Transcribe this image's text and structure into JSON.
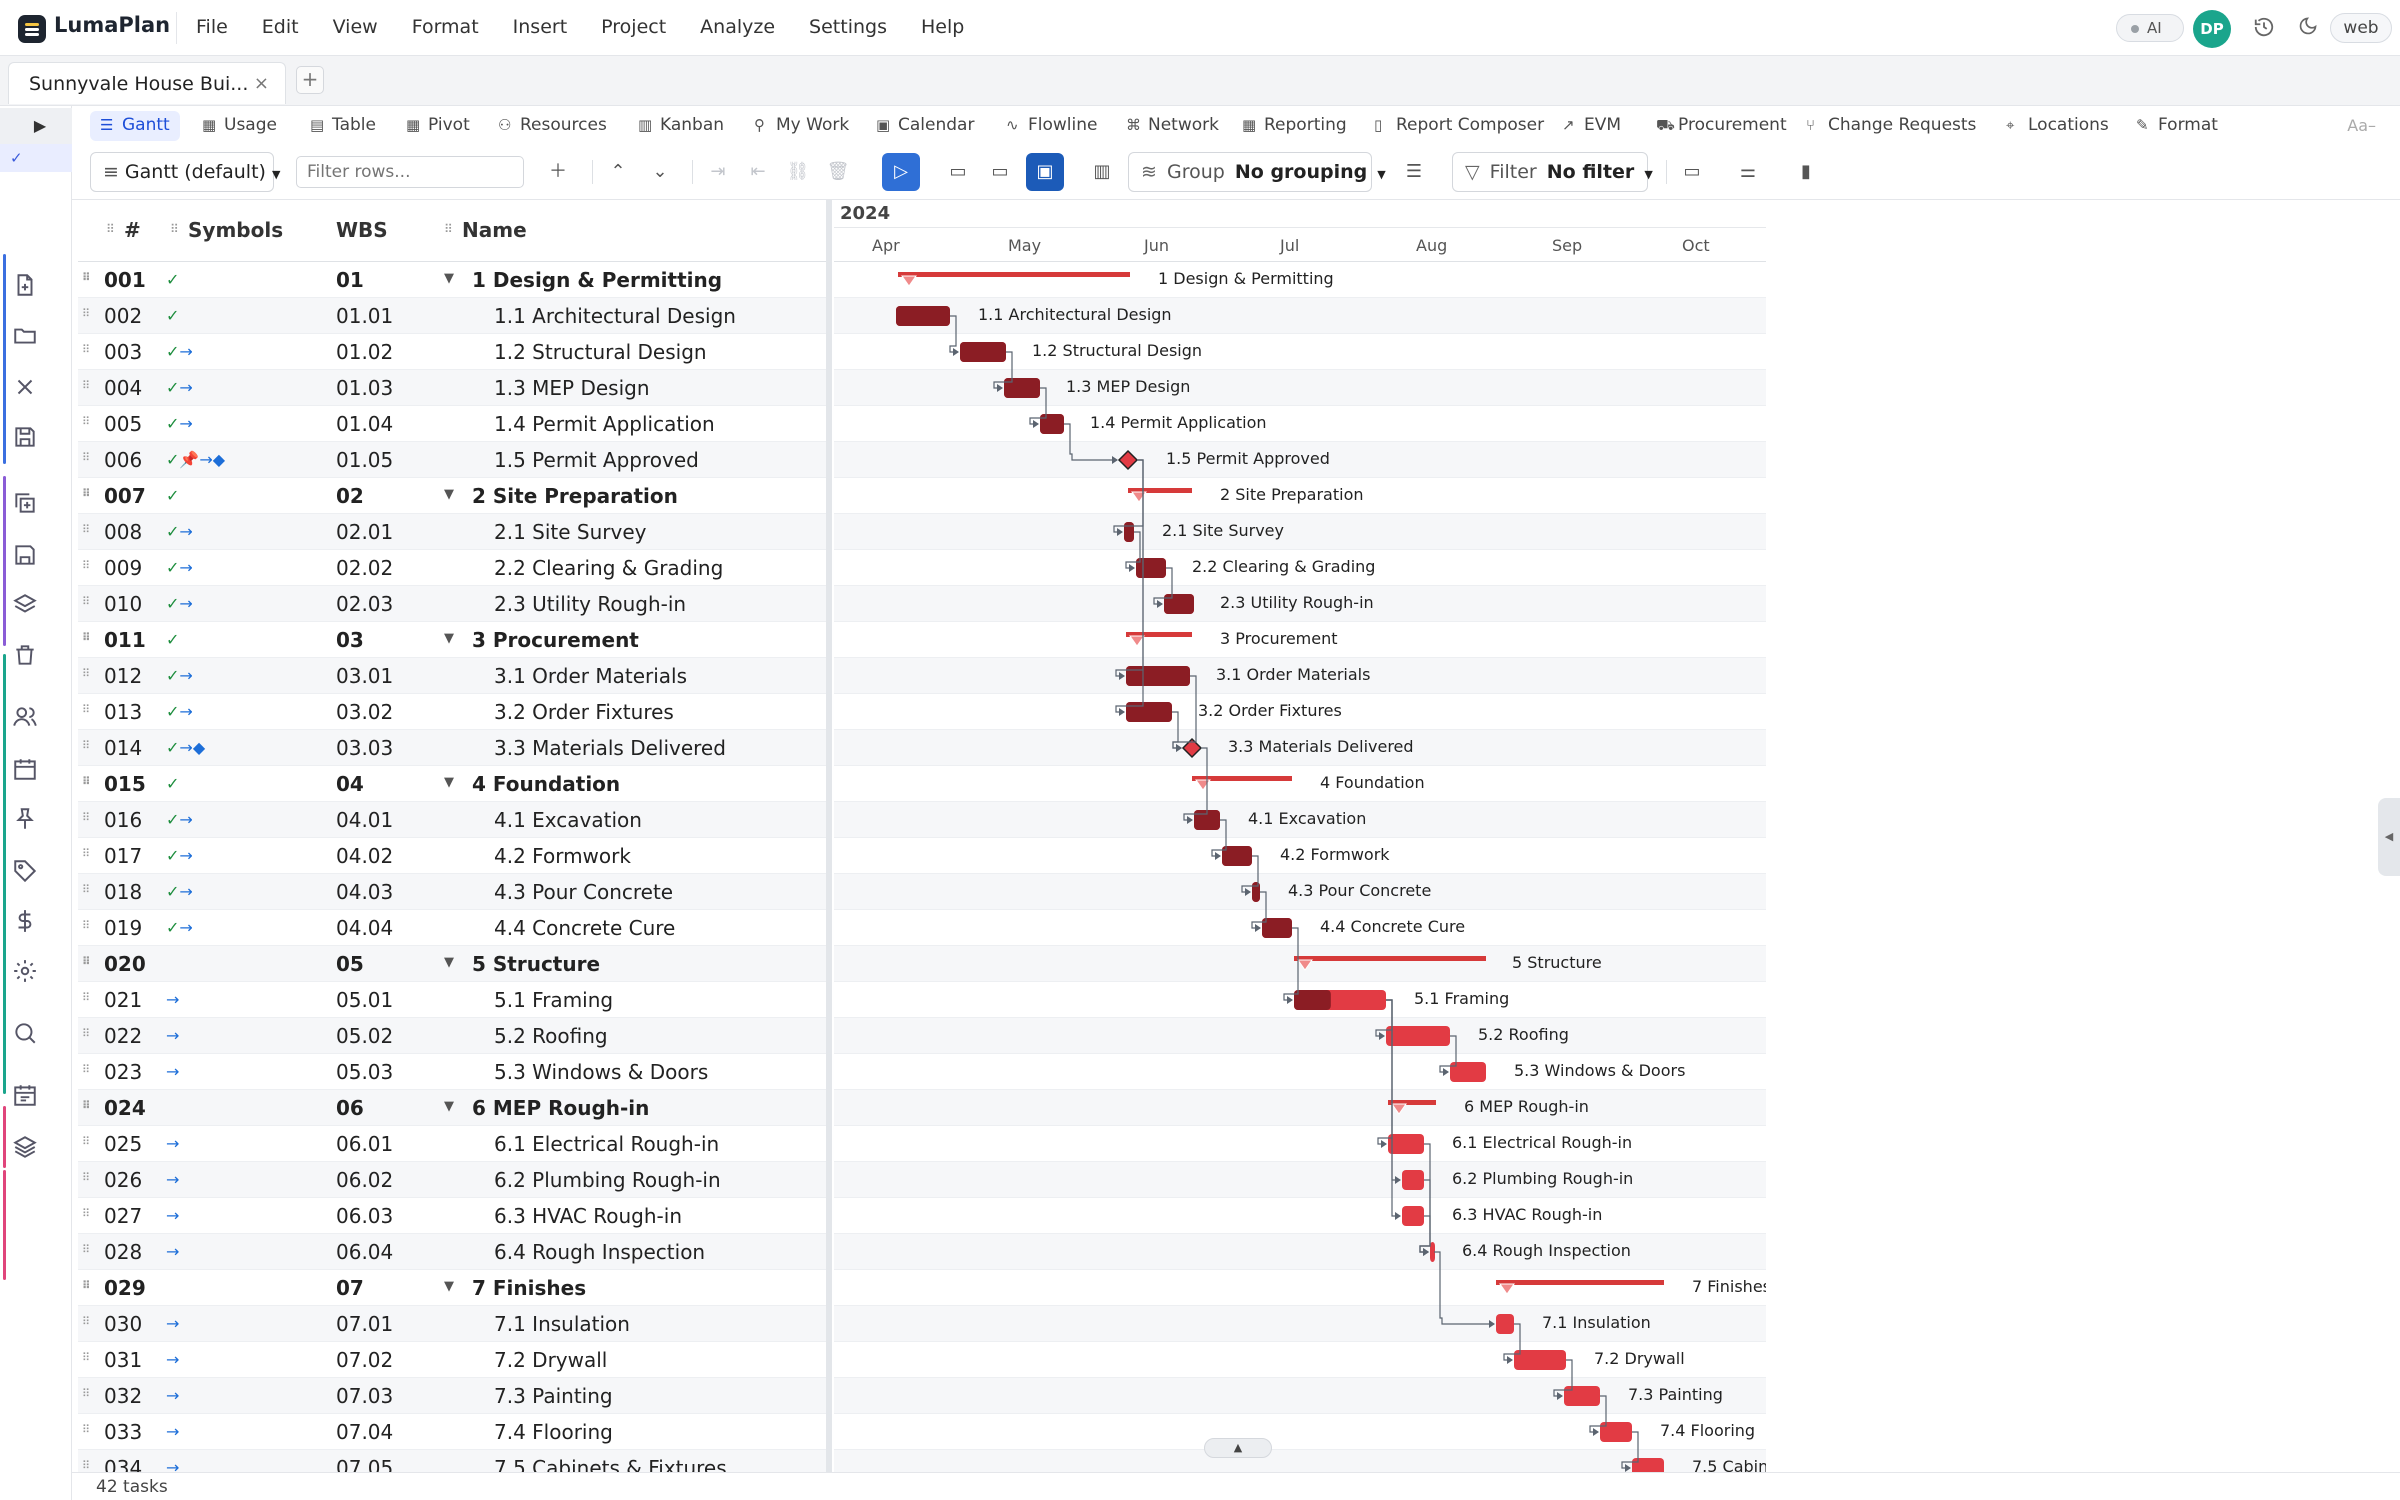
{
  "app": {
    "name": "LumaPlan"
  },
  "menu": [
    "File",
    "Edit",
    "View",
    "Format",
    "Insert",
    "Project",
    "Analyze",
    "Settings",
    "Help"
  ],
  "header": {
    "ai_label": "AI",
    "avatar_initials": "DP",
    "env_label": "web",
    "avatar_color": "#1aa58c"
  },
  "doc_tab": {
    "title": "Sunnyvale House Bui...",
    "close": "×",
    "new_tab": "+"
  },
  "view_tabs": [
    {
      "label": "Gantt",
      "icon": "gantt-icon",
      "active": true
    },
    {
      "label": "Usage",
      "icon": "usage-icon"
    },
    {
      "label": "Table",
      "icon": "table-icon"
    },
    {
      "label": "Pivot",
      "icon": "pivot-icon"
    },
    {
      "label": "Resources",
      "icon": "resources-icon"
    },
    {
      "label": "Kanban",
      "icon": "kanban-icon"
    },
    {
      "label": "My Work",
      "icon": "my-work-icon"
    },
    {
      "label": "Calendar",
      "icon": "calendar-icon"
    },
    {
      "label": "Flowline",
      "icon": "flowline-icon"
    },
    {
      "label": "Network",
      "icon": "network-icon"
    },
    {
      "label": "Reporting",
      "icon": "reporting-icon"
    },
    {
      "label": "Report Composer",
      "icon": "report-composer-icon"
    },
    {
      "label": "EVM",
      "icon": "evm-icon"
    },
    {
      "label": "Procurement",
      "icon": "procurement-icon"
    },
    {
      "label": "Change Requests",
      "icon": "change-requests-icon"
    },
    {
      "label": "Locations",
      "icon": "locations-icon"
    },
    {
      "label": "Format",
      "icon": "format-icon"
    }
  ],
  "view_tabs_font_label": "Aa–",
  "toolbar": {
    "view_select": "Gantt (default)",
    "filter_placeholder": "Filter rows...",
    "group_label": "Group",
    "group_value": "No grouping",
    "filter_label": "Filter",
    "filter_value": "No filter"
  },
  "columns": {
    "num": "#",
    "symbols": "Symbols",
    "wbs": "WBS",
    "name": "Name"
  },
  "timeline": {
    "year": "2024",
    "months": [
      "Apr",
      "May",
      "Jun",
      "Jul",
      "Aug",
      "Sep",
      "Oct"
    ]
  },
  "colors": {
    "accent": "#2f6fd6",
    "bar_dark": "#8b1d24",
    "bar_light": "#e23b44",
    "summary_bar": "#d63a3a",
    "check_green": "#1e8e3e",
    "link_blue": "#1d6ed8"
  },
  "rows": [
    {
      "num": "001",
      "sym": "✓",
      "wbs": "01",
      "name": "1 Design & Permitting",
      "summary": true
    },
    {
      "num": "002",
      "sym": "✓",
      "wbs": "01.01",
      "name": "1.1 Architectural Design"
    },
    {
      "num": "003",
      "sym": "✓→",
      "wbs": "01.02",
      "name": "1.2 Structural Design"
    },
    {
      "num": "004",
      "sym": "✓→",
      "wbs": "01.03",
      "name": "1.3 MEP Design"
    },
    {
      "num": "005",
      "sym": "✓→",
      "wbs": "01.04",
      "name": "1.4 Permit Application"
    },
    {
      "num": "006",
      "sym": "✓📌→◆",
      "wbs": "01.05",
      "name": "1.5 Permit Approved"
    },
    {
      "num": "007",
      "sym": "✓",
      "wbs": "02",
      "name": "2 Site Preparation",
      "summary": true
    },
    {
      "num": "008",
      "sym": "✓→",
      "wbs": "02.01",
      "name": "2.1 Site Survey"
    },
    {
      "num": "009",
      "sym": "✓→",
      "wbs": "02.02",
      "name": "2.2 Clearing & Grading"
    },
    {
      "num": "010",
      "sym": "✓→",
      "wbs": "02.03",
      "name": "2.3 Utility Rough-in"
    },
    {
      "num": "011",
      "sym": "✓",
      "wbs": "03",
      "name": "3 Procurement",
      "summary": true
    },
    {
      "num": "012",
      "sym": "✓→",
      "wbs": "03.01",
      "name": "3.1 Order Materials"
    },
    {
      "num": "013",
      "sym": "✓→",
      "wbs": "03.02",
      "name": "3.2 Order Fixtures"
    },
    {
      "num": "014",
      "sym": "✓→◆",
      "wbs": "03.03",
      "name": "3.3 Materials Delivered"
    },
    {
      "num": "015",
      "sym": "✓",
      "wbs": "04",
      "name": "4 Foundation",
      "summary": true
    },
    {
      "num": "016",
      "sym": "✓→",
      "wbs": "04.01",
      "name": "4.1 Excavation"
    },
    {
      "num": "017",
      "sym": "✓→",
      "wbs": "04.02",
      "name": "4.2 Formwork"
    },
    {
      "num": "018",
      "sym": "✓→",
      "wbs": "04.03",
      "name": "4.3 Pour Concrete"
    },
    {
      "num": "019",
      "sym": "✓→",
      "wbs": "04.04",
      "name": "4.4 Concrete Cure"
    },
    {
      "num": "020",
      "sym": "",
      "wbs": "05",
      "name": "5 Structure",
      "summary": true
    },
    {
      "num": "021",
      "sym": "→",
      "wbs": "05.01",
      "name": "5.1 Framing"
    },
    {
      "num": "022",
      "sym": "→",
      "wbs": "05.02",
      "name": "5.2 Roofing"
    },
    {
      "num": "023",
      "sym": "→",
      "wbs": "05.03",
      "name": "5.3 Windows & Doors"
    },
    {
      "num": "024",
      "sym": "",
      "wbs": "06",
      "name": "6 MEP Rough-in",
      "summary": true
    },
    {
      "num": "025",
      "sym": "→",
      "wbs": "06.01",
      "name": "6.1 Electrical Rough-in"
    },
    {
      "num": "026",
      "sym": "→",
      "wbs": "06.02",
      "name": "6.2 Plumbing Rough-in"
    },
    {
      "num": "027",
      "sym": "→",
      "wbs": "06.03",
      "name": "6.3 HVAC Rough-in"
    },
    {
      "num": "028",
      "sym": "→",
      "wbs": "06.04",
      "name": "6.4 Rough Inspection"
    },
    {
      "num": "029",
      "sym": "",
      "wbs": "07",
      "name": "7 Finishes",
      "summary": true
    },
    {
      "num": "030",
      "sym": "→",
      "wbs": "07.01",
      "name": "7.1 Insulation"
    },
    {
      "num": "031",
      "sym": "→",
      "wbs": "07.02",
      "name": "7.2 Drywall"
    },
    {
      "num": "032",
      "sym": "→",
      "wbs": "07.03",
      "name": "7.3 Painting"
    },
    {
      "num": "033",
      "sym": "→",
      "wbs": "07.04",
      "name": "7.4 Flooring"
    },
    {
      "num": "034",
      "sym": "→",
      "wbs": "07.05",
      "name": "7.5 Cabinets & Fixtures"
    }
  ],
  "status": {
    "task_count": "42 tasks"
  }
}
